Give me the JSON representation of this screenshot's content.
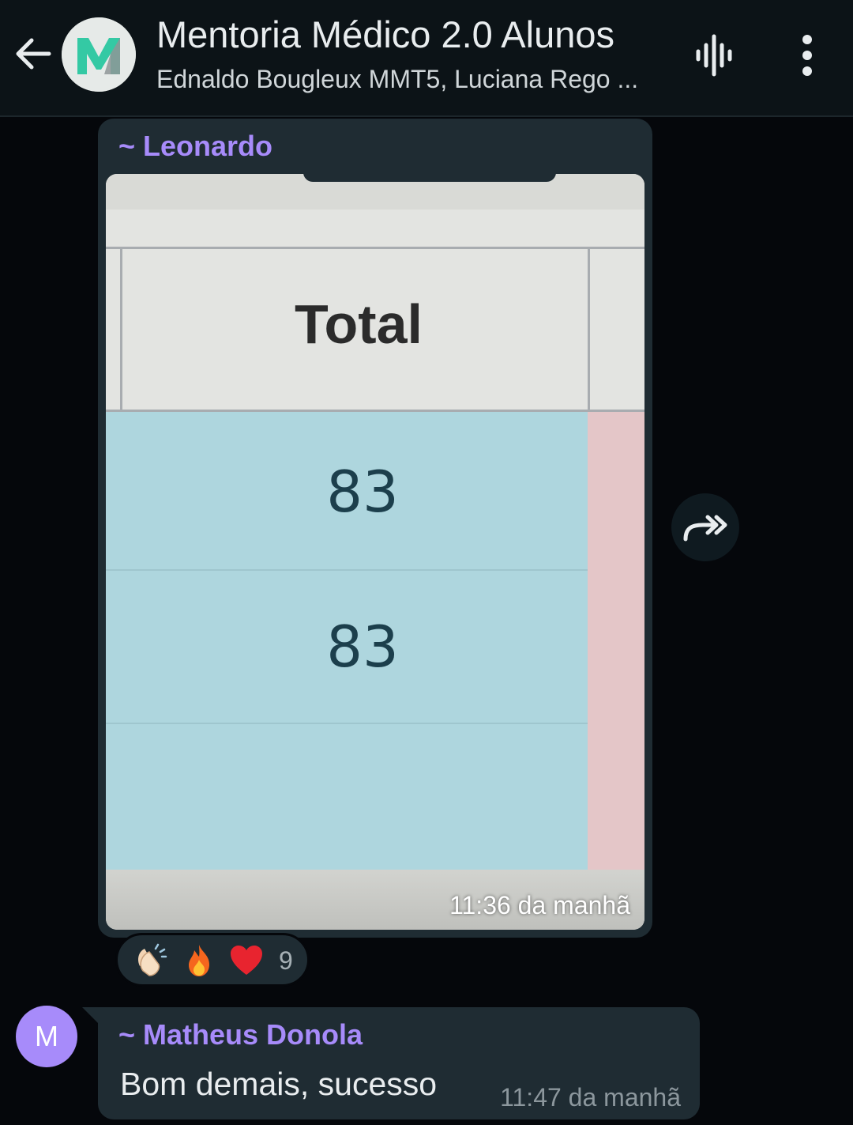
{
  "header": {
    "title": "Mentoria Médico 2.0 Alunos",
    "subtitle": "Ednaldo Bougleux MMT5, Luciana Rego ...",
    "back_icon": "arrow-left-icon",
    "voice_icon": "voice-wave-icon",
    "menu_icon": "more-vertical-icon"
  },
  "messages": [
    {
      "sender": "~ Leonardo",
      "type": "image",
      "image": {
        "header_label": "Total",
        "values": [
          "83",
          "83"
        ]
      },
      "time": "11:36 da manhã",
      "reactions": {
        "emojis": [
          "clapping-hands",
          "fire",
          "red-heart"
        ],
        "count": "9"
      }
    },
    {
      "sender": "~ Matheus Donola",
      "avatar_letter": "M",
      "text": "Bom demais, sucesso",
      "time": "11:47 da manhã"
    }
  ],
  "colors": {
    "header_bg": "#0c1317",
    "chat_bg": "#05070b",
    "bubble_bg": "#1f2c33",
    "sender_name": "#a78bfa",
    "avatar_bg": "#a78bfa"
  }
}
